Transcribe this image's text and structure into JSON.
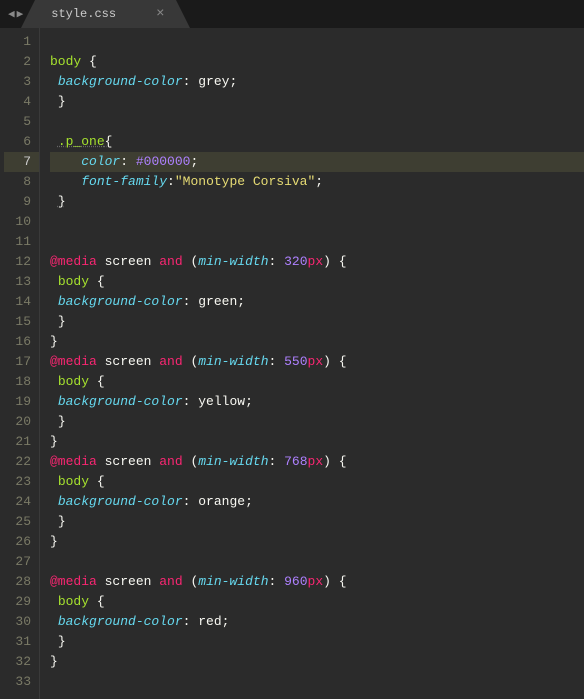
{
  "tab": {
    "filename": "style.css",
    "close": "×"
  },
  "nav": {
    "left": "◀",
    "right": "▶"
  },
  "activeLine": 7,
  "code": {
    "lines": [
      {
        "n": 1,
        "tokens": []
      },
      {
        "n": 2,
        "tokens": [
          {
            "t": "body",
            "c": "tok-sel"
          },
          {
            "t": " ",
            "c": ""
          },
          {
            "t": "{",
            "c": "tok-punc"
          }
        ]
      },
      {
        "n": 3,
        "tokens": [
          {
            "t": " ",
            "c": ""
          },
          {
            "t": "background-color",
            "c": "tok-prop"
          },
          {
            "t": ": ",
            "c": "tok-punc"
          },
          {
            "t": "grey",
            "c": "tok-val"
          },
          {
            "t": ";",
            "c": "tok-punc"
          }
        ]
      },
      {
        "n": 4,
        "tokens": [
          {
            "t": " ",
            "c": ""
          },
          {
            "t": "}",
            "c": "tok-punc"
          }
        ]
      },
      {
        "n": 5,
        "tokens": []
      },
      {
        "n": 6,
        "tokens": [
          {
            "t": " ",
            "c": ""
          },
          {
            "t": ".p_one",
            "c": "tok-classsel tok-decor"
          },
          {
            "t": "{",
            "c": "tok-punc tok-decor"
          }
        ]
      },
      {
        "n": 7,
        "tokens": [
          {
            "t": "    ",
            "c": ""
          },
          {
            "t": "color",
            "c": "tok-prop"
          },
          {
            "t": ": ",
            "c": "tok-punc"
          },
          {
            "t": "#000000",
            "c": "tok-num"
          },
          {
            "t": ";",
            "c": "tok-punc"
          }
        ]
      },
      {
        "n": 8,
        "tokens": [
          {
            "t": "    ",
            "c": ""
          },
          {
            "t": "font-family",
            "c": "tok-prop"
          },
          {
            "t": ":",
            "c": "tok-punc"
          },
          {
            "t": "\"Monotype Corsiva\"",
            "c": "tok-str"
          },
          {
            "t": ";",
            "c": "tok-punc"
          }
        ]
      },
      {
        "n": 9,
        "tokens": [
          {
            "t": " ",
            "c": ""
          },
          {
            "t": "}",
            "c": "tok-punc tok-decor"
          }
        ]
      },
      {
        "n": 10,
        "tokens": []
      },
      {
        "n": 11,
        "tokens": []
      },
      {
        "n": 12,
        "tokens": [
          {
            "t": "@media",
            "c": "tok-at"
          },
          {
            "t": " ",
            "c": ""
          },
          {
            "t": "screen",
            "c": "tok-val"
          },
          {
            "t": " ",
            "c": ""
          },
          {
            "t": "and",
            "c": "tok-kw"
          },
          {
            "t": " ",
            "c": ""
          },
          {
            "t": "(",
            "c": "tok-punc"
          },
          {
            "t": "min-width",
            "c": "tok-fn"
          },
          {
            "t": ": ",
            "c": "tok-punc"
          },
          {
            "t": "320",
            "c": "tok-num"
          },
          {
            "t": "px",
            "c": "tok-kw"
          },
          {
            "t": ") ",
            "c": "tok-punc"
          },
          {
            "t": "{",
            "c": "tok-punc"
          }
        ]
      },
      {
        "n": 13,
        "tokens": [
          {
            "t": " ",
            "c": ""
          },
          {
            "t": "body",
            "c": "tok-sel"
          },
          {
            "t": " ",
            "c": ""
          },
          {
            "t": "{",
            "c": "tok-punc"
          }
        ]
      },
      {
        "n": 14,
        "tokens": [
          {
            "t": " ",
            "c": ""
          },
          {
            "t": "background-color",
            "c": "tok-prop"
          },
          {
            "t": ": ",
            "c": "tok-punc"
          },
          {
            "t": "green",
            "c": "tok-val"
          },
          {
            "t": ";",
            "c": "tok-punc"
          }
        ]
      },
      {
        "n": 15,
        "tokens": [
          {
            "t": " ",
            "c": ""
          },
          {
            "t": "}",
            "c": "tok-punc"
          }
        ]
      },
      {
        "n": 16,
        "tokens": [
          {
            "t": "}",
            "c": "tok-punc"
          }
        ]
      },
      {
        "n": 17,
        "tokens": [
          {
            "t": "@media",
            "c": "tok-at"
          },
          {
            "t": " ",
            "c": ""
          },
          {
            "t": "screen",
            "c": "tok-val"
          },
          {
            "t": " ",
            "c": ""
          },
          {
            "t": "and",
            "c": "tok-kw"
          },
          {
            "t": " ",
            "c": ""
          },
          {
            "t": "(",
            "c": "tok-punc"
          },
          {
            "t": "min-width",
            "c": "tok-fn"
          },
          {
            "t": ": ",
            "c": "tok-punc"
          },
          {
            "t": "550",
            "c": "tok-num"
          },
          {
            "t": "px",
            "c": "tok-kw"
          },
          {
            "t": ") ",
            "c": "tok-punc"
          },
          {
            "t": "{",
            "c": "tok-punc"
          }
        ]
      },
      {
        "n": 18,
        "tokens": [
          {
            "t": " ",
            "c": ""
          },
          {
            "t": "body",
            "c": "tok-sel"
          },
          {
            "t": " ",
            "c": ""
          },
          {
            "t": "{",
            "c": "tok-punc"
          }
        ]
      },
      {
        "n": 19,
        "tokens": [
          {
            "t": " ",
            "c": ""
          },
          {
            "t": "background-color",
            "c": "tok-prop"
          },
          {
            "t": ": ",
            "c": "tok-punc"
          },
          {
            "t": "yellow",
            "c": "tok-val"
          },
          {
            "t": ";",
            "c": "tok-punc"
          }
        ]
      },
      {
        "n": 20,
        "tokens": [
          {
            "t": " ",
            "c": ""
          },
          {
            "t": "}",
            "c": "tok-punc"
          }
        ]
      },
      {
        "n": 21,
        "tokens": [
          {
            "t": "}",
            "c": "tok-punc"
          }
        ]
      },
      {
        "n": 22,
        "tokens": [
          {
            "t": "@media",
            "c": "tok-at"
          },
          {
            "t": " ",
            "c": ""
          },
          {
            "t": "screen",
            "c": "tok-val"
          },
          {
            "t": " ",
            "c": ""
          },
          {
            "t": "and",
            "c": "tok-kw"
          },
          {
            "t": " ",
            "c": ""
          },
          {
            "t": "(",
            "c": "tok-punc"
          },
          {
            "t": "min-width",
            "c": "tok-fn"
          },
          {
            "t": ": ",
            "c": "tok-punc"
          },
          {
            "t": "768",
            "c": "tok-num"
          },
          {
            "t": "px",
            "c": "tok-kw"
          },
          {
            "t": ") ",
            "c": "tok-punc"
          },
          {
            "t": "{",
            "c": "tok-punc"
          }
        ]
      },
      {
        "n": 23,
        "tokens": [
          {
            "t": " ",
            "c": ""
          },
          {
            "t": "body",
            "c": "tok-sel"
          },
          {
            "t": " ",
            "c": ""
          },
          {
            "t": "{",
            "c": "tok-punc"
          }
        ]
      },
      {
        "n": 24,
        "tokens": [
          {
            "t": " ",
            "c": ""
          },
          {
            "t": "background-color",
            "c": "tok-prop"
          },
          {
            "t": ": ",
            "c": "tok-punc"
          },
          {
            "t": "orange",
            "c": "tok-val"
          },
          {
            "t": ";",
            "c": "tok-punc"
          }
        ]
      },
      {
        "n": 25,
        "tokens": [
          {
            "t": " ",
            "c": ""
          },
          {
            "t": "}",
            "c": "tok-punc"
          }
        ]
      },
      {
        "n": 26,
        "tokens": [
          {
            "t": "}",
            "c": "tok-punc"
          }
        ]
      },
      {
        "n": 27,
        "tokens": []
      },
      {
        "n": 28,
        "tokens": [
          {
            "t": "@media",
            "c": "tok-at"
          },
          {
            "t": " ",
            "c": ""
          },
          {
            "t": "screen",
            "c": "tok-val"
          },
          {
            "t": " ",
            "c": ""
          },
          {
            "t": "and",
            "c": "tok-kw"
          },
          {
            "t": " ",
            "c": ""
          },
          {
            "t": "(",
            "c": "tok-punc"
          },
          {
            "t": "min-width",
            "c": "tok-fn"
          },
          {
            "t": ": ",
            "c": "tok-punc"
          },
          {
            "t": "960",
            "c": "tok-num"
          },
          {
            "t": "px",
            "c": "tok-kw"
          },
          {
            "t": ") ",
            "c": "tok-punc"
          },
          {
            "t": "{",
            "c": "tok-punc"
          }
        ]
      },
      {
        "n": 29,
        "tokens": [
          {
            "t": " ",
            "c": ""
          },
          {
            "t": "body",
            "c": "tok-sel"
          },
          {
            "t": " ",
            "c": ""
          },
          {
            "t": "{",
            "c": "tok-punc"
          }
        ]
      },
      {
        "n": 30,
        "tokens": [
          {
            "t": " ",
            "c": ""
          },
          {
            "t": "background-color",
            "c": "tok-prop"
          },
          {
            "t": ": ",
            "c": "tok-punc"
          },
          {
            "t": "red",
            "c": "tok-val"
          },
          {
            "t": ";",
            "c": "tok-punc"
          }
        ]
      },
      {
        "n": 31,
        "tokens": [
          {
            "t": " ",
            "c": ""
          },
          {
            "t": "}",
            "c": "tok-punc"
          }
        ]
      },
      {
        "n": 32,
        "tokens": [
          {
            "t": "}",
            "c": "tok-punc"
          }
        ]
      },
      {
        "n": 33,
        "tokens": []
      }
    ]
  }
}
